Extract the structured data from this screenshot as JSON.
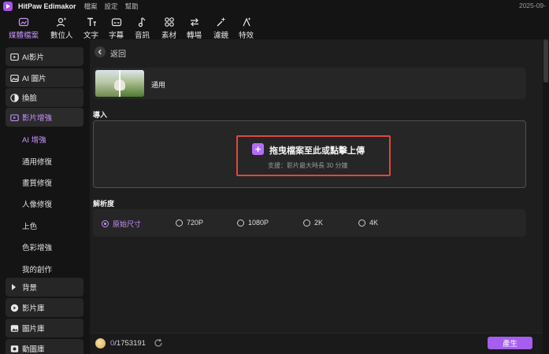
{
  "titlebar": {
    "app_name": "HitPaw Edimakor",
    "menu": [
      "檔案",
      "設定",
      "幫助"
    ],
    "clock": "2025-09-"
  },
  "toolbar": {
    "items": [
      {
        "label": "媒體檔案",
        "icon": "media-icon",
        "active": true
      },
      {
        "label": "數位人",
        "icon": "digital-human-icon"
      },
      {
        "label": "文字",
        "icon": "text-icon"
      },
      {
        "label": "字幕",
        "icon": "subtitle-icon"
      },
      {
        "label": "音訊",
        "icon": "audio-icon"
      },
      {
        "label": "素材",
        "icon": "assets-icon"
      },
      {
        "label": "轉場",
        "icon": "transition-icon"
      },
      {
        "label": "濾鏡",
        "icon": "filter-icon"
      },
      {
        "label": "特效",
        "icon": "effects-icon"
      }
    ]
  },
  "sidebar": {
    "items": [
      {
        "label": "AI影片",
        "icon": "ai-video-icon"
      },
      {
        "label": "AI 圖片",
        "icon": "ai-image-icon"
      },
      {
        "label": "換臉",
        "icon": "face-swap-icon"
      },
      {
        "label": "影片增強",
        "icon": "video-enhance-icon",
        "active": true
      },
      {
        "label": "背景",
        "icon": "caret-right-icon"
      },
      {
        "label": "影片庫",
        "icon": "video-library-icon"
      },
      {
        "label": "圖片庫",
        "icon": "image-library-icon"
      },
      {
        "label": "動圖庫",
        "icon": "gif-library-icon"
      }
    ],
    "subitems": [
      "AI 增強",
      "通用修復",
      "畫質修復",
      "人像修復",
      "上色",
      "色彩增強",
      "我的創作"
    ]
  },
  "main": {
    "back_label": "返回",
    "model_name": "通用",
    "import_label": "導入",
    "upload_title": "拖曳檔案至此或點擊上傳",
    "upload_sub": "支援：影片最大時長 30 分鐘",
    "resolution_label": "解析度",
    "resolutions": [
      "原始尺寸",
      "720P",
      "1080P",
      "2K",
      "4K"
    ],
    "selected_resolution": "原始尺寸"
  },
  "bottom": {
    "credits_used": "0",
    "credits_total": "/1753191",
    "generate_label": "產生"
  },
  "colors": {
    "accent": "#c792f9",
    "button": "#a55ef0",
    "highlight_border": "#e0473c",
    "background": "#141414",
    "panel": "#1e1e1e",
    "card": "#262626"
  }
}
